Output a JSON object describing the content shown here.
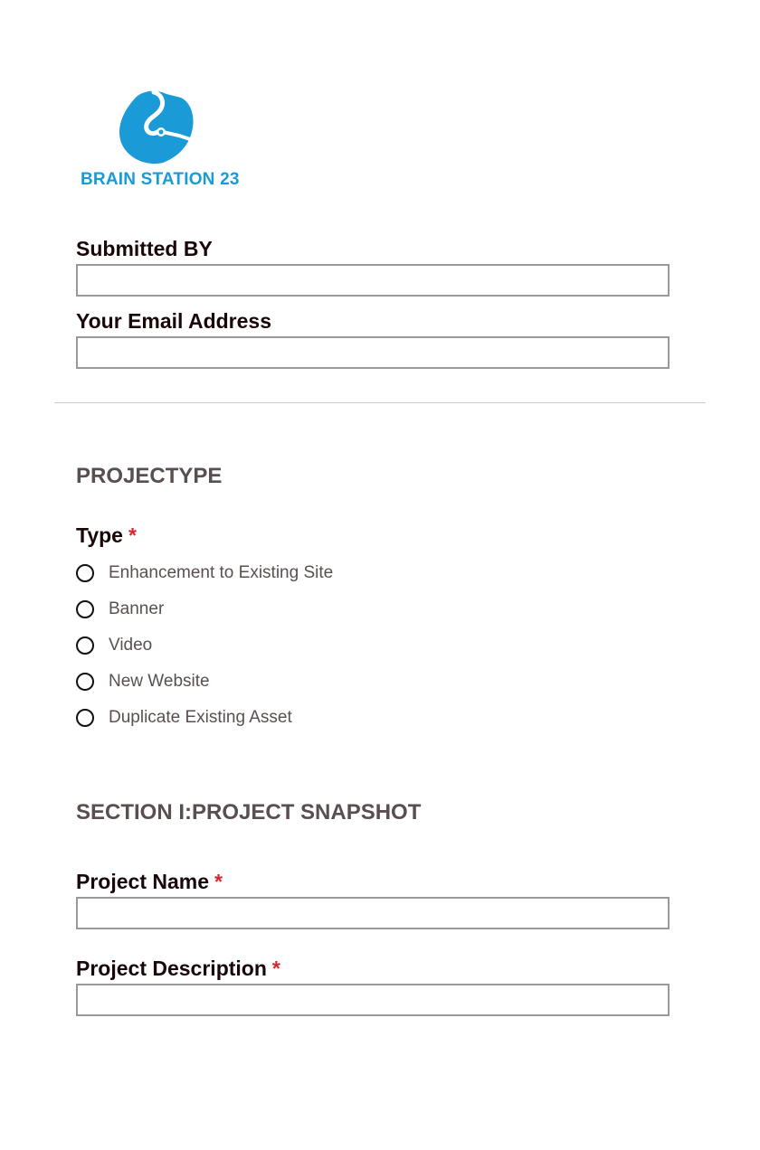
{
  "brand": {
    "name": "BRAIN STATION 23",
    "color": "#1a9ad6"
  },
  "header_fields": {
    "submitted_by": {
      "label": "Submitted BY",
      "value": ""
    },
    "email": {
      "label": "Your Email Address",
      "value": ""
    }
  },
  "project_type": {
    "heading": "PROJECTYPE",
    "type_label": "Type",
    "required_mark": "*",
    "options": [
      {
        "label": "Enhancement to Existing Site",
        "selected": false
      },
      {
        "label": "Banner",
        "selected": false
      },
      {
        "label": "Video",
        "selected": false
      },
      {
        "label": "New Website",
        "selected": false
      },
      {
        "label": "Duplicate Existing Asset",
        "selected": false
      }
    ]
  },
  "snapshot": {
    "heading": "SECTION I:PROJECT SNAPSHOT",
    "project_name": {
      "label": "Project Name",
      "required_mark": "*",
      "value": ""
    },
    "project_description": {
      "label": "Project Description",
      "required_mark": "*",
      "value": ""
    }
  },
  "colors": {
    "label": "#1a0808",
    "section_heading": "#5a4f4f",
    "required": "#d9252d",
    "input_border": "#9a9a9a",
    "divider": "#cfcfcf"
  }
}
